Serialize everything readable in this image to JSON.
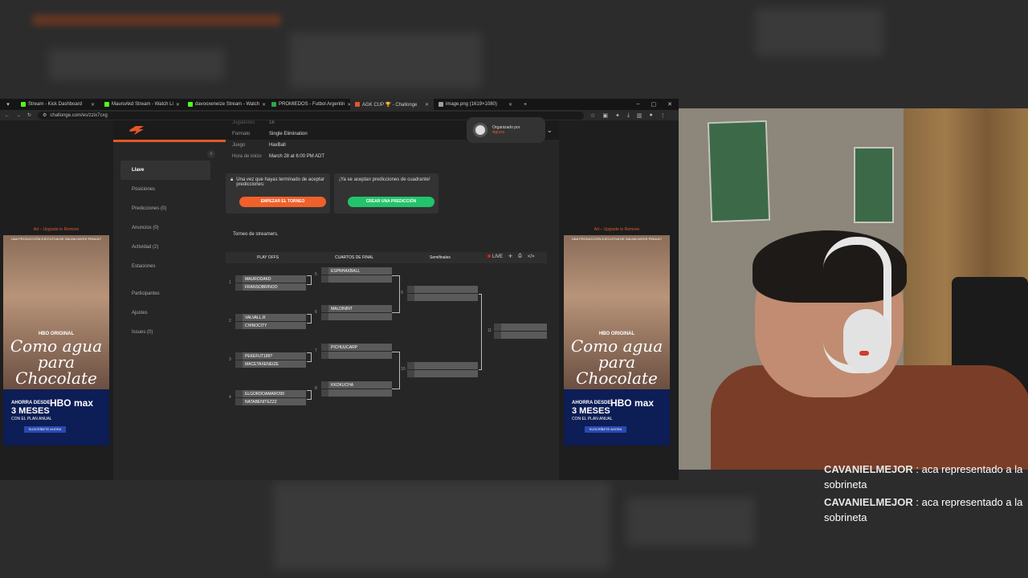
{
  "browser": {
    "tabs": [
      {
        "label": "Stream - Kick Dashboard",
        "color": "#53fc18"
      },
      {
        "label": "MauroAkd Stream - Watch Li",
        "color": "#53fc18"
      },
      {
        "label": "davooxeneize Stream - Watch",
        "color": "#53fc18"
      },
      {
        "label": "PROMIEDOS - Futbol Argentin",
        "color": "#2aa64a"
      },
      {
        "label": "AGK CUP 🏆 - Challonge",
        "color": "#e5572a"
      },
      {
        "label": "image.png (1619×1080)",
        "color": "#9aa0a6"
      }
    ],
    "new_tab": "+",
    "url": "challonge.com/es/zzix7cxg"
  },
  "sidenav": {
    "items": [
      "Llave",
      "Posiciones",
      "Predicciones (0)",
      "Anuncios (0)",
      "Actividad (2)",
      "Estaciones"
    ],
    "items2": [
      "Participantes",
      "Ajustes",
      "Issues (0)"
    ]
  },
  "info": {
    "rows": [
      {
        "k": "Jugadores",
        "v": "16"
      },
      {
        "k": "Formato",
        "v": "Single Elimination"
      },
      {
        "k": "Juego",
        "v": "HaxBall"
      },
      {
        "k": "Hora de inicio",
        "v": "March 28 at 6:00 PM ADT"
      }
    ],
    "org_label": "Organizado por",
    "org_name": "Agrura"
  },
  "cards": {
    "c1_text": "Una vez que hayas terminado de aceptar predicciones:",
    "c1_button": "Empezar el torneo",
    "c2_text": "¡Ya se aceptan predicciones de cuadrante!",
    "c2_button": "Crear una predicción"
  },
  "description": "Torneo de streamers.",
  "bracket": {
    "rounds": [
      "PLAY OFFS",
      "CUARTOS DE FINAL",
      "Semifinales"
    ],
    "live": "LIVE",
    "r1": [
      {
        "n": "1",
        "a": "MAURODAKD",
        "b": "FRANSOBRINOO"
      },
      {
        "n": "2",
        "a": "VALVALL.R",
        "b": "CHINOCITY"
      },
      {
        "n": "3",
        "a": "PEKEFUT189?",
        "b": "MACETAXENEIZE"
      },
      {
        "n": "4",
        "a": "ELGORDOAMARO99",
        "b": "NATABENITEZZZ"
      }
    ],
    "r2": [
      {
        "n": "5",
        "a": "ESPNHAXBALL",
        "b": ""
      },
      {
        "n": "6",
        "a": "MALDININT",
        "b": ""
      },
      {
        "n": "7",
        "a": "PICHUUCARP",
        "b": ""
      },
      {
        "n": "8",
        "a": "KKOKUCHA",
        "b": ""
      }
    ],
    "r3": [
      {
        "n": "9"
      },
      {
        "n": "10"
      }
    ],
    "r4": [
      {
        "n": "11"
      }
    ]
  },
  "ad": {
    "top": "Ad – Upgrade to Remove",
    "tag": "UNA PRODUCCIÓN EJECUTIVA DE SALMA HAYEK PINAULT",
    "hbo": "HBO ORIGINAL",
    "title": "Como agua para Chocolate",
    "l1": "AHORRA DESDE",
    "l2": "3 MESES",
    "l3": "CON EL PLAN ANUAL",
    "logo": "HBO max",
    "cta": "SUSCRÍBETE AHORA"
  },
  "chat": [
    {
      "user": "CAVANIELMEJOR",
      "text": ": aca representado a la sobrineta"
    },
    {
      "user": "CAVANIELMEJOR",
      "text": ": aca representado a la sobrineta"
    }
  ]
}
